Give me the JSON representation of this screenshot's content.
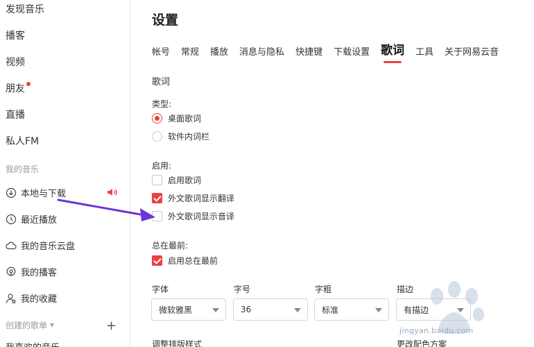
{
  "sidebar": {
    "nav": [
      "发现音乐",
      "播客",
      "视频",
      "朋友",
      "直播",
      "私人FM"
    ],
    "my_music_header": "我的音乐",
    "my_items": [
      "本地与下载",
      "最近播放",
      "我的音乐云盘",
      "我的播客",
      "我的收藏"
    ],
    "created_header": "创建的歌单",
    "cut_item": "我喜欢的音乐"
  },
  "main": {
    "title": "设置",
    "tabs": [
      "帐号",
      "常规",
      "播放",
      "消息与隐私",
      "快捷键",
      "下载设置",
      "歌词",
      "工具",
      "关于网易云音"
    ],
    "section_title": "歌词",
    "type_label": "类型:",
    "type_options": [
      {
        "label": "桌面歌词",
        "selected": true
      },
      {
        "label": "软件内词栏",
        "selected": false
      }
    ],
    "enable_label": "启用:",
    "enable_options": [
      {
        "label": "启用歌词",
        "checked": false
      },
      {
        "label": "外文歌词显示翻译",
        "checked": true
      },
      {
        "label": "外文歌词显示音译",
        "checked": false
      }
    ],
    "ontop_label": "总在最前:",
    "ontop_option": {
      "label": "启用总在最前",
      "checked": true
    },
    "font_label": "字体",
    "font_value": "微软雅黑",
    "size_label": "字号",
    "size_value": "36",
    "weight_label": "字粗",
    "weight_value": "标准",
    "stroke_label": "描边",
    "stroke_value": "有描边",
    "layout_label": "调整排版样式",
    "color_label": "更改配色方案"
  },
  "watermark": "jingyan.baidu.com",
  "colors": {
    "accent": "#ec4141",
    "arrow": "#6a35d8"
  }
}
